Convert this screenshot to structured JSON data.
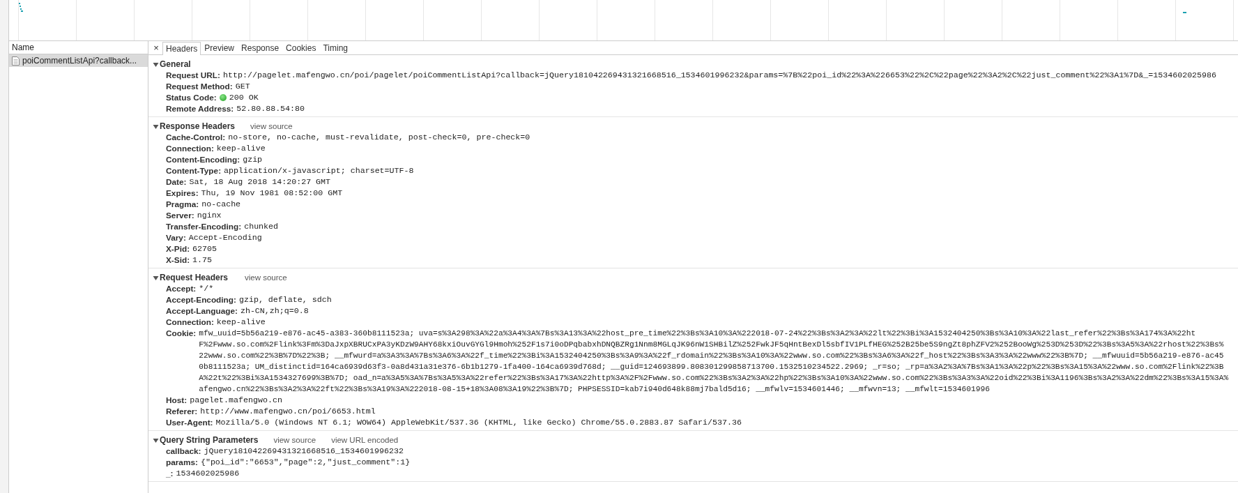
{
  "name_column": {
    "header": "Name",
    "requests": [
      {
        "name": "poiCommentListApi?callback...",
        "selected": true
      }
    ]
  },
  "detail": {
    "close": "×",
    "tabs": [
      {
        "label": "Headers",
        "selected": true
      },
      {
        "label": "Preview",
        "selected": false
      },
      {
        "label": "Response",
        "selected": false
      },
      {
        "label": "Cookies",
        "selected": false
      },
      {
        "label": "Timing",
        "selected": false
      }
    ],
    "sections": [
      {
        "title": "General",
        "expanded": true,
        "rows": [
          {
            "key": "Request URL:",
            "value": "http://pagelet.mafengwo.cn/poi/pagelet/poiCommentListApi?callback=jQuery181042269431321668516_1534601996232&params=%7B%22poi_id%22%3A%226653%22%2C%22page%22%3A2%2C%22just_comment%22%3A1%7D&_=1534602025986"
          },
          {
            "key": "Request Method:",
            "value": "GET"
          },
          {
            "key": "Status Code:",
            "value": "200 OK",
            "kind": "status"
          },
          {
            "key": "Remote Address:",
            "value": "52.80.88.54:80"
          }
        ]
      },
      {
        "title": "Response Headers",
        "expanded": true,
        "links": [
          "view source"
        ],
        "rows": [
          {
            "key": "Cache-Control:",
            "value": "no-store, no-cache, must-revalidate, post-check=0, pre-check=0"
          },
          {
            "key": "Connection:",
            "value": "keep-alive"
          },
          {
            "key": "Content-Encoding:",
            "value": "gzip"
          },
          {
            "key": "Content-Type:",
            "value": "application/x-javascript; charset=UTF-8"
          },
          {
            "key": "Date:",
            "value": "Sat, 18 Aug 2018 14:20:27 GMT"
          },
          {
            "key": "Expires:",
            "value": "Thu, 19 Nov 1981 08:52:00 GMT"
          },
          {
            "key": "Pragma:",
            "value": "no-cache"
          },
          {
            "key": "Server:",
            "value": "nginx"
          },
          {
            "key": "Transfer-Encoding:",
            "value": "chunked"
          },
          {
            "key": "Vary:",
            "value": "Accept-Encoding"
          },
          {
            "key": "X-Pid:",
            "value": "62705"
          },
          {
            "key": "X-Sid:",
            "value": "1.75"
          }
        ]
      },
      {
        "title": "Request Headers",
        "expanded": true,
        "links": [
          "view source"
        ],
        "rows": [
          {
            "key": "Accept:",
            "value": "*/*"
          },
          {
            "key": "Accept-Encoding:",
            "value": "gzip, deflate, sdch"
          },
          {
            "key": "Accept-Language:",
            "value": "zh-CN,zh;q=0.8"
          },
          {
            "key": "Connection:",
            "value": "keep-alive"
          },
          {
            "key": "Cookie:",
            "kind": "wrapped",
            "value_lines": [
              "mfw_uuid=5b56a219-e876-ac45-a383-360b8111523a; uva=s%3A298%3A%22a%3A4%3A%7Bs%3A13%3A%22host_pre_time%22%3Bs%3A10%3A%222018-07-24%22%3Bs%3A2%3A%22lt%22%3Bi%3A1532404250%3Bs%3A10%3A%22last_refer%22%3Bs%3A174%3A%22ht",
              "F%2Fwww.so.com%2Flink%3Fm%3DaJxpXBRUCxPA3yKDzW9AHY68kxiOuvGYGl9Hmoh%252F1s7i0oDPqbabxhDNQBZRg1Nnm8MGLqJK96nW1SHBilZ%252FwkJF5qHntBexDl5sbfIV1PLfHEG%252B25be5S9ngZt8phZFV2%252BooWg%253D%253D%22%3Bs%3A5%3A%22rhost%22%3Bs%",
              "22www.so.com%22%3B%7D%22%3B; __mfwurd=a%3A3%3A%7Bs%3A6%3A%22f_time%22%3Bi%3A1532404250%3Bs%3A9%3A%22f_rdomain%22%3Bs%3A10%3A%22www.so.com%22%3Bs%3A6%3A%22f_host%22%3Bs%3A3%3A%22www%22%3B%7D; __mfwuuid=5b56a219-e876-ac45",
              "0b8111523a; UM_distinctid=164ca6939d63f3-0a8d431a31e376-6b1b1279-1fa400-164ca6939d768d; __guid=124693899.808301299858713700.1532510234522.2969; _r=so; _rp=a%3A2%3A%7Bs%3A1%3A%22p%22%3Bs%3A15%3A%22www.so.com%2Flink%22%3B",
              "A%22t%22%3Bi%3A1534327699%3B%7D; oad_n=a%3A5%3A%7Bs%3A5%3A%22refer%22%3Bs%3A17%3A%22http%3A%2F%2Fwww.so.com%22%3Bs%3A2%3A%22hp%22%3Bs%3A10%3A%22www.so.com%22%3Bs%3A3%3A%22oid%22%3Bi%3A1196%3Bs%3A2%3A%22dm%22%3Bs%3A15%3A%",
              "afengwo.cn%22%3Bs%3A2%3A%22ft%22%3Bs%3A19%3A%222018-08-15+18%3A08%3A19%22%3B%7D; PHPSESSID=kab7i940d648k88mj7bald5d16; __mfwlv=1534601446; __mfwvn=13; __mfwlt=1534601996"
            ]
          },
          {
            "key": "Host:",
            "value": "pagelet.mafengwo.cn"
          },
          {
            "key": "Referer:",
            "value": "http://www.mafengwo.cn/poi/6653.html"
          },
          {
            "key": "User-Agent:",
            "value": "Mozilla/5.0 (Windows NT 6.1; WOW64) AppleWebKit/537.36 (KHTML, like Gecko) Chrome/55.0.2883.87 Safari/537.36"
          }
        ]
      },
      {
        "title": "Query String Parameters",
        "expanded": true,
        "links": [
          "view source",
          "view URL encoded"
        ],
        "rows": [
          {
            "key": "callback:",
            "value": "jQuery181042269431321668516_1534601996232"
          },
          {
            "key": "params:",
            "value": "{\"poi_id\":\"6653\",\"page\":2,\"just_comment\":1}"
          },
          {
            "key": "_:",
            "value": "1534602025986"
          }
        ]
      }
    ]
  }
}
